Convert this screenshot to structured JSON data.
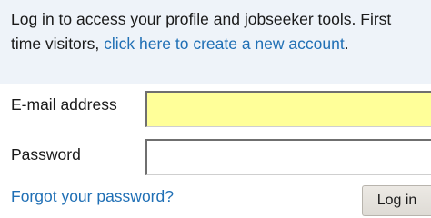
{
  "intro": {
    "text_before": "Log in to access your profile and jobseeker tools. First time visitors, ",
    "link_text": "click here to create a new account",
    "text_after": "."
  },
  "form": {
    "email_label": "E-mail address",
    "email_value": "",
    "password_label": "Password",
    "password_value": "",
    "forgot_link": "Forgot your password?",
    "login_button": "Log in"
  },
  "colors": {
    "intro_background": "#eef3f9",
    "link": "#1f6fb5",
    "email_field_background": "#ffff99"
  }
}
